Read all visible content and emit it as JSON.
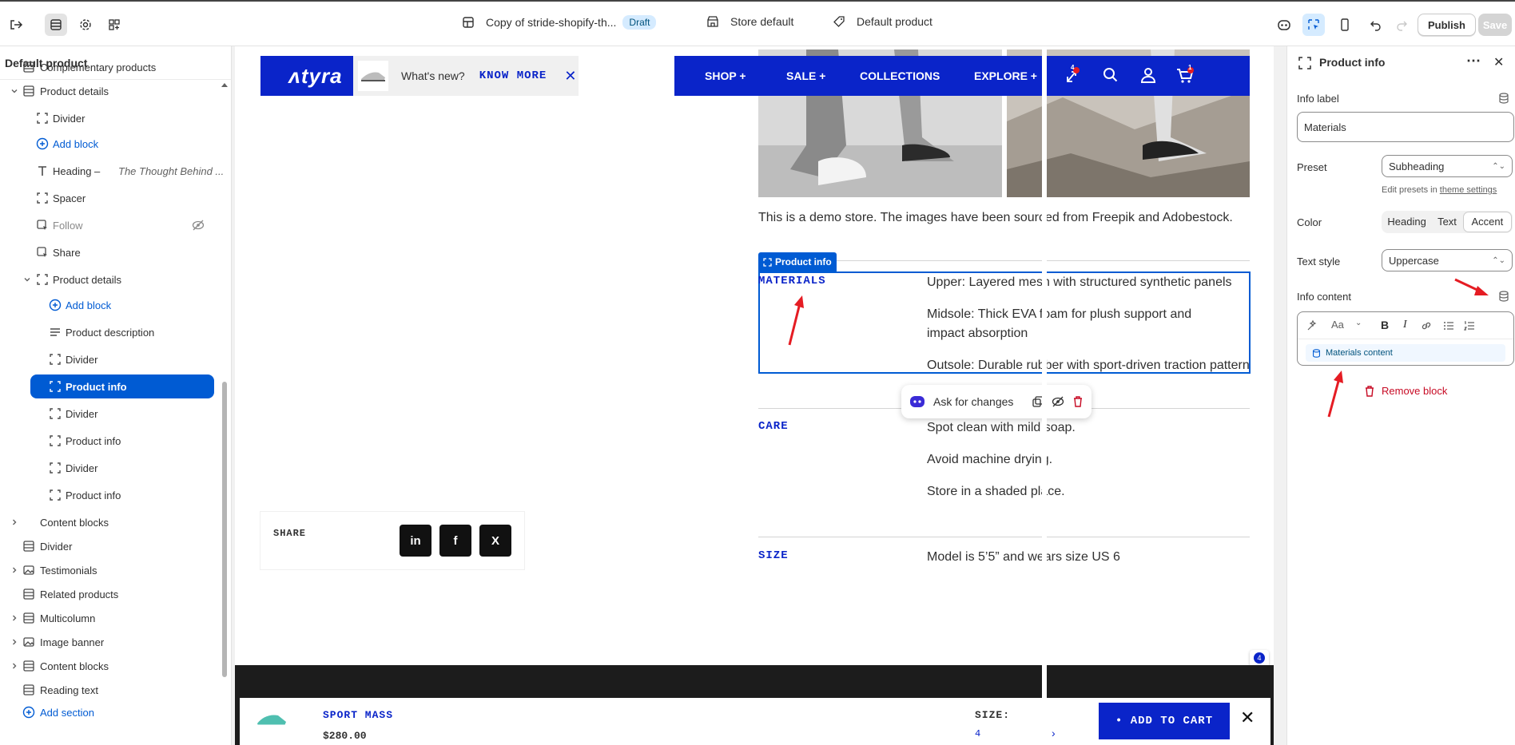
{
  "topbar": {
    "theme_name": "Copy of stride-shopify-th...",
    "theme_status": "Draft",
    "store": "Store default",
    "template": "Default product",
    "publish": "Publish",
    "save": "Save"
  },
  "sidebar": {
    "title": "Default product",
    "items": [
      {
        "label": "Complementary products"
      },
      {
        "label": "Product details"
      },
      {
        "label": "Divider"
      },
      {
        "label": "Add block"
      },
      {
        "label": "Heading – ",
        "italic": "The Thought Behind ..."
      },
      {
        "label": "Spacer"
      },
      {
        "label": "Follow"
      },
      {
        "label": "Share"
      },
      {
        "label": "Product details"
      },
      {
        "label": "Add block"
      },
      {
        "label": "Product description"
      },
      {
        "label": "Divider"
      },
      {
        "label": "Product info"
      },
      {
        "label": "Divider"
      },
      {
        "label": "Product info"
      },
      {
        "label": "Divider"
      },
      {
        "label": "Product info"
      },
      {
        "label": "Content blocks"
      },
      {
        "label": "Divider"
      },
      {
        "label": "Testimonials"
      },
      {
        "label": "Related products"
      },
      {
        "label": "Multicolumn"
      },
      {
        "label": "Image banner"
      },
      {
        "label": "Content blocks"
      },
      {
        "label": "Reading text"
      },
      {
        "label": "Add section"
      }
    ]
  },
  "preview": {
    "logo": "ᴧtyra",
    "news": {
      "text": "What's new?",
      "link": "KNOW MORE"
    },
    "nav": [
      "SHOP +",
      "SALE +",
      "COLLECTIONS",
      "EXPLORE +"
    ],
    "compare_count": "4",
    "cart_count": "1",
    "demo_text": "This is a demo store. The images have been sourced from Freepik and Adobestock.",
    "product_info_tag": "Product info",
    "accordions": [
      {
        "label": "MATERIALS",
        "lines": [
          "Upper: Layered mesh with structured synthetic panels",
          "Midsole: Thick EVA foam for plush support and impact absorption",
          "Outsole: Durable rubber with sport-driven traction pattern"
        ]
      },
      {
        "label": "CARE",
        "lines": [
          "Spot clean with mild soap.",
          "Avoid machine drying.",
          "Store in a shaded place."
        ]
      },
      {
        "label": "SIZE",
        "lines": [
          "Model is 5’5” and wears size US 6"
        ]
      }
    ],
    "ask_changes": "Ask for changes",
    "share": {
      "label": "SHARE",
      "buttons": [
        "in",
        "f",
        "X"
      ]
    },
    "side_badge": "4",
    "sticky": {
      "name": "SPORT MASS",
      "price": "$280.00",
      "size_label": "SIZE:",
      "size_value": "4",
      "cta": "• ADD TO CART"
    }
  },
  "panel": {
    "title": "Product info",
    "info_label": "Info label",
    "info_label_value": "Materials",
    "preset_label": "Preset",
    "preset_value": "Subheading",
    "preset_help": "Edit presets in ",
    "preset_help_link": "theme settings",
    "color_label": "Color",
    "color_options": [
      "Heading",
      "Text",
      "Accent"
    ],
    "color_selected": "Accent",
    "text_style_label": "Text style",
    "text_style_value": "Uppercase",
    "info_content_label": "Info content",
    "rte_font": "Aa",
    "dynamic_source": "Materials content",
    "remove": "Remove block"
  },
  "colors": {
    "accent": "#0a24c9",
    "admin_blue": "#005bd3",
    "remove_red": "#c70a24",
    "annotation": "#e51c23"
  }
}
